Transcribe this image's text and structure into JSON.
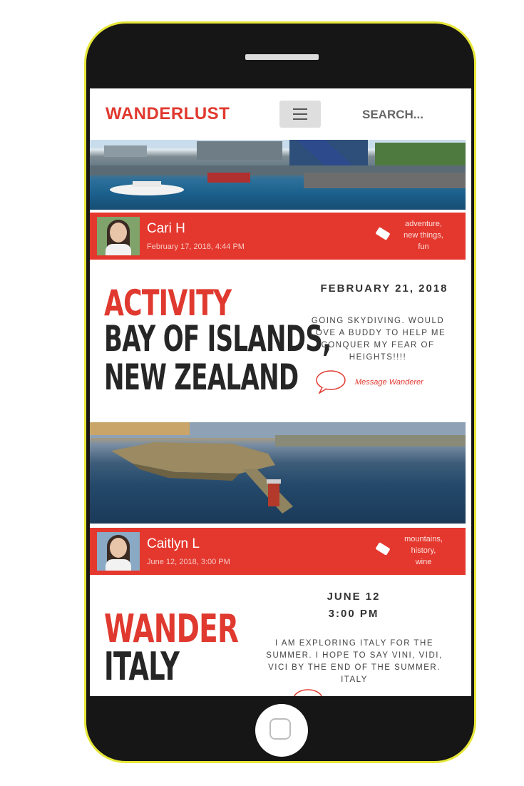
{
  "header": {
    "logo": "WANDERLUST",
    "search_label": "SEARCH..."
  },
  "posts": [
    {
      "user": {
        "name": "Cari H",
        "date": "February 17, 2018, 4:44 PM"
      },
      "tags": [
        "adventure,",
        "new things,",
        "fun"
      ],
      "category": "ACTIVITY",
      "location_lines": [
        "BAY OF ISLANDS,",
        "NEW ZEALAND"
      ],
      "date_line_1": "FEBRUARY 21, 2018",
      "date_line_2": "",
      "description": "GOING SKYDIVING. WOULD LOVE A BUDDY TO HELP ME CONQUER MY FEAR OF HEIGHTS!!!!",
      "message_label": "Message Wanderer"
    },
    {
      "user": {
        "name": "Caitlyn L",
        "date": "June 12, 2018, 3:00 PM"
      },
      "tags": [
        "mountains,",
        "history,",
        "wine"
      ],
      "category": "WANDER",
      "location_lines": [
        "ITALY"
      ],
      "date_line_1": "JUNE 12",
      "date_line_2": "3:00 PM",
      "description": "I AM EXPLORING ITALY FOR THE SUMMER. I HOPE TO SAY VINI, VIDI, VICI BY THE END OF THE SUMMER. ITALY",
      "message_label": ""
    }
  ],
  "colors": {
    "accent": "#e0392f",
    "userbar": "#e4382e",
    "phone_border": "#e6e639"
  },
  "icons": [
    "menu-icon",
    "tag-icon",
    "speech-bubble-icon"
  ]
}
